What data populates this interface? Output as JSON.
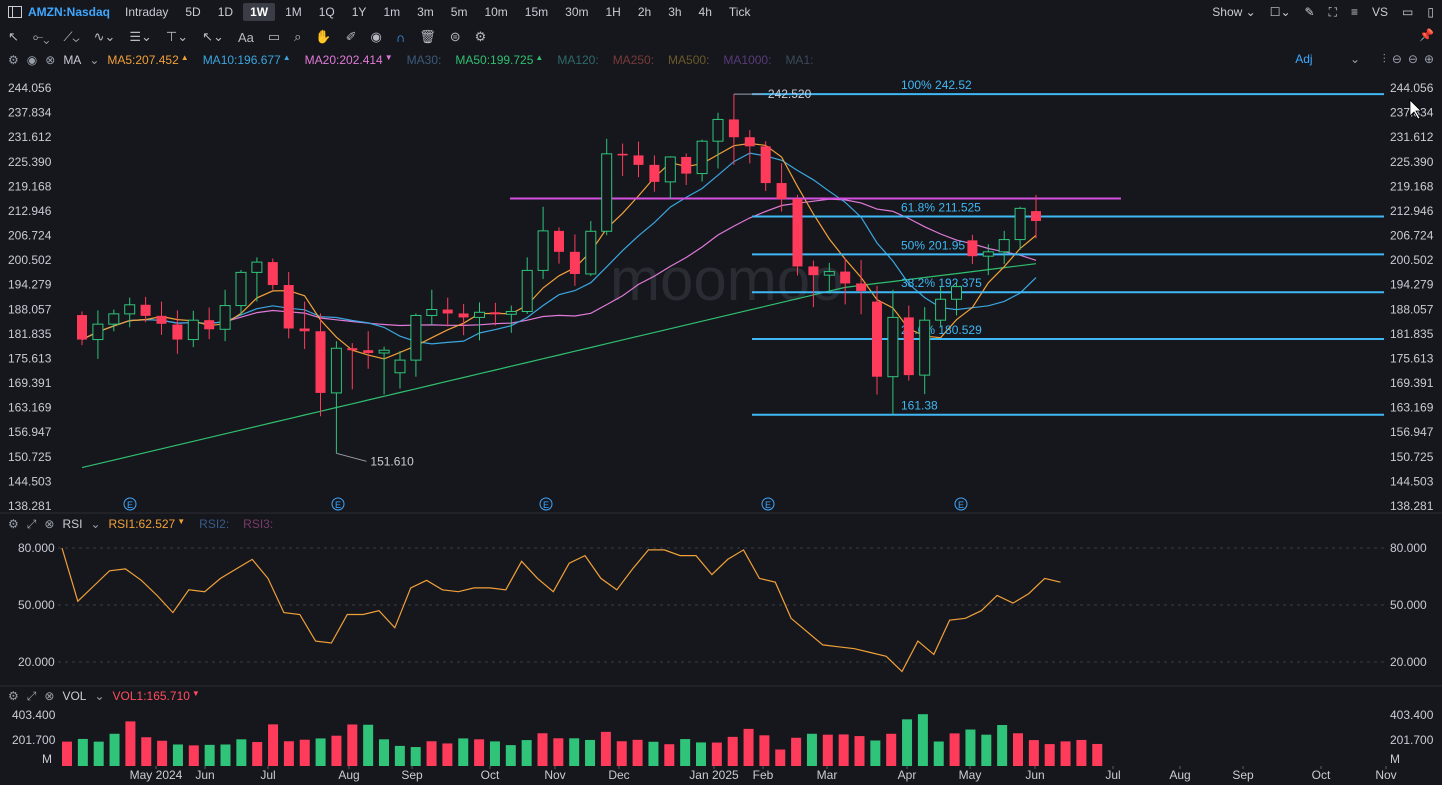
{
  "header": {
    "symbol": "AMZN:Nasdaq",
    "timeframes": [
      "Intraday",
      "5D",
      "1D",
      "1W",
      "1M",
      "1Q",
      "1Y",
      "1m",
      "3m",
      "5m",
      "10m",
      "15m",
      "30m",
      "1H",
      "2h",
      "3h",
      "4h",
      "Tick"
    ],
    "active_timeframe": "1W",
    "show_label": "Show",
    "vs_label": "VS"
  },
  "main_panel": {
    "indicator_name": "MA",
    "ma_labels": [
      {
        "text": "MA5:207.452",
        "color": "#f0a03a",
        "arrow": "▲"
      },
      {
        "text": "MA10:196.677",
        "color": "#3aa6e0",
        "arrow": "▲"
      },
      {
        "text": "MA20:202.414",
        "color": "#e07ad8",
        "arrow": "▼"
      },
      {
        "text": "MA30:",
        "color": "#3a5a7a",
        "arrow": ""
      },
      {
        "text": "MA50:199.725",
        "color": "#2fbf6f",
        "arrow": "▲"
      },
      {
        "text": "MA120:",
        "color": "#2e6a6a",
        "arrow": ""
      },
      {
        "text": "MA250:",
        "color": "#7a3a3a",
        "arrow": ""
      },
      {
        "text": "MA500:",
        "color": "#6a5a2a",
        "arrow": ""
      },
      {
        "text": "MA1000:",
        "color": "#5a3a7a",
        "arrow": ""
      },
      {
        "text": "MA1:",
        "color": "#3a4a5a",
        "arrow": ""
      }
    ],
    "adj_label": "Adj"
  },
  "rsi_panel": {
    "name": "RSI",
    "labels": [
      {
        "text": "RSI1:62.527",
        "color": "#f0a03a",
        "arrow": "▼"
      },
      {
        "text": "RSI2:",
        "color": "#3a5a8a",
        "arrow": ""
      },
      {
        "text": "RSI3:",
        "color": "#7a3a6a",
        "arrow": ""
      }
    ]
  },
  "vol_panel": {
    "name": "VOL",
    "labels": [
      {
        "text": "VOL1:165.710",
        "color": "#ff4d5e",
        "arrow": "▼"
      }
    ]
  },
  "chart_data": {
    "type": "candlestick",
    "price_axis_ticks": [
      "244.056",
      "237.834",
      "231.612",
      "225.390",
      "219.168",
      "212.946",
      "206.724",
      "200.502",
      "194.279",
      "188.057",
      "181.835",
      "175.613",
      "169.391",
      "163.169",
      "156.947",
      "150.725",
      "144.503",
      "138.281"
    ],
    "ylim": [
      138.281,
      244.056
    ],
    "x_month_labels": [
      "May 2024",
      "Jun",
      "Jul",
      "Aug",
      "Sep",
      "Oct",
      "Nov",
      "Dec",
      "Jan 2025",
      "Feb",
      "Mar",
      "Apr",
      "May",
      "Jun",
      "Jul",
      "Aug",
      "Sep",
      "Oct",
      "Nov"
    ],
    "candles": [
      [
        186.6,
        187.5,
        179.0,
        180.4
      ],
      [
        180.4,
        187.8,
        175.5,
        184.3
      ],
      [
        184.3,
        188.0,
        182.5,
        186.9
      ],
      [
        186.9,
        191.0,
        183.5,
        189.2
      ],
      [
        189.2,
        191.2,
        184.8,
        186.4
      ],
      [
        186.4,
        190.0,
        181.6,
        184.4
      ],
      [
        184.2,
        187.8,
        176.8,
        180.4
      ],
      [
        180.4,
        187.7,
        178.5,
        185.3
      ],
      [
        185.3,
        188.5,
        180.5,
        183.0
      ],
      [
        183.0,
        193.0,
        180.0,
        189.0
      ],
      [
        189.0,
        198.0,
        186.5,
        197.4
      ],
      [
        197.4,
        201.2,
        190.0,
        200.0
      ],
      [
        200.0,
        200.9,
        193.0,
        194.2
      ],
      [
        194.2,
        197.5,
        180.7,
        183.2
      ],
      [
        183.2,
        190.0,
        178.0,
        182.5
      ],
      [
        182.5,
        187.0,
        161.0,
        166.9
      ],
      [
        166.9,
        180.0,
        151.6,
        178.2
      ],
      [
        178.2,
        179.5,
        167.8,
        177.7
      ],
      [
        177.7,
        182.5,
        173.0,
        177.0
      ],
      [
        177.0,
        178.6,
        166.5,
        177.7
      ],
      [
        172.0,
        177.5,
        168.0,
        175.2
      ],
      [
        175.2,
        187.0,
        171.0,
        186.5
      ],
      [
        186.5,
        193.0,
        184.0,
        188.0
      ],
      [
        188.0,
        191.0,
        183.7,
        187.0
      ],
      [
        187.0,
        189.4,
        181.5,
        186.0
      ],
      [
        186.0,
        189.8,
        180.2,
        187.3
      ],
      [
        187.3,
        189.7,
        184.0,
        186.8
      ],
      [
        186.8,
        189.0,
        182.1,
        187.5
      ],
      [
        187.5,
        201.2,
        186.9,
        197.9
      ],
      [
        197.9,
        214.0,
        195.7,
        207.9
      ],
      [
        207.9,
        208.8,
        199.6,
        202.6
      ],
      [
        202.6,
        207.0,
        194.0,
        197.0
      ],
      [
        197.0,
        210.4,
        196.5,
        207.8
      ],
      [
        207.8,
        231.2,
        206.8,
        227.4
      ],
      [
        227.4,
        230.0,
        221.8,
        227.0
      ],
      [
        227.0,
        230.5,
        221.5,
        224.6
      ],
      [
        224.6,
        227.0,
        217.8,
        220.3
      ],
      [
        220.3,
        226.8,
        216.0,
        226.6
      ],
      [
        226.6,
        227.5,
        219.5,
        222.4
      ],
      [
        222.4,
        231.0,
        220.4,
        230.6
      ],
      [
        230.6,
        237.8,
        223.7,
        236.1
      ],
      [
        236.1,
        242.5,
        224.6,
        231.6
      ],
      [
        231.6,
        233.4,
        225.0,
        229.3
      ],
      [
        229.3,
        230.6,
        218.0,
        220.0
      ],
      [
        220.0,
        225.0,
        212.8,
        216.0
      ],
      [
        216.0,
        217.0,
        196.6,
        198.9
      ],
      [
        198.9,
        200.4,
        188.6,
        196.7
      ],
      [
        196.7,
        199.8,
        192.0,
        197.6
      ],
      [
        197.6,
        201.0,
        189.3,
        194.6
      ],
      [
        194.6,
        200.5,
        186.8,
        192.7
      ],
      [
        190.0,
        194.0,
        166.5,
        171.0
      ],
      [
        171.0,
        193.0,
        161.4,
        186.0
      ],
      [
        186.0,
        189.0,
        170.0,
        171.4
      ],
      [
        171.4,
        188.6,
        166.6,
        185.3
      ],
      [
        185.3,
        194.0,
        183.7,
        190.6
      ],
      [
        190.6,
        195.0,
        186.5,
        193.8
      ],
      [
        205.5,
        206.9,
        199.5,
        201.5
      ],
      [
        201.5,
        204.5,
        196.7,
        202.6
      ],
      [
        202.6,
        207.9,
        199.5,
        205.7
      ],
      [
        205.7,
        214.0,
        203.1,
        213.6
      ],
      [
        212.9,
        217.0,
        206.0,
        210.4
      ]
    ],
    "annotations": {
      "high_label": "242.520",
      "low_label": "151.610",
      "fib_levels": [
        {
          "label": "100% 242.52",
          "value": 242.52
        },
        {
          "label": "61.8% 211.525",
          "value": 211.525
        },
        {
          "label": "50% 201.95",
          "value": 201.95
        },
        {
          "label": "38.2% 192.375",
          "value": 192.375
        },
        {
          "label": "23.6% 180.529",
          "value": 180.529
        },
        {
          "label": "161.38",
          "value": 161.38
        }
      ],
      "horizontal_line": 216.1,
      "event_marker": "E"
    },
    "rsi": {
      "ticks": [
        "80.000",
        "50.000",
        "20.000"
      ],
      "ylim": [
        10,
        88
      ],
      "values": [
        80,
        52,
        60,
        68,
        69,
        63,
        55,
        46,
        58,
        57,
        64,
        69,
        74,
        64,
        46,
        45,
        31,
        30,
        45,
        45,
        47,
        38,
        59,
        63,
        58,
        57,
        59,
        59,
        58,
        73,
        64,
        57,
        72,
        76,
        64,
        58,
        69,
        79,
        79,
        76,
        76,
        66,
        74,
        79,
        64,
        62,
        43,
        36,
        29,
        28,
        27,
        25,
        23,
        15,
        31,
        24,
        42,
        43,
        47,
        55,
        51,
        56,
        64,
        62
      ]
    },
    "volume": {
      "ticks": [
        "403.400",
        "201.700",
        "M"
      ],
      "ylim": [
        0,
        440
      ],
      "values": [
        189,
        210,
        189,
        250,
        346,
        223,
        196,
        167,
        160,
        164,
        167,
        207,
        186,
        323,
        192,
        204,
        214,
        235,
        322,
        320,
        207,
        156,
        147,
        192,
        175,
        214,
        207,
        191,
        162,
        201,
        254,
        215,
        215,
        202,
        265,
        192,
        203,
        188,
        169,
        209,
        183,
        182,
        226,
        288,
        238,
        128,
        219,
        250,
        243,
        245,
        232,
        198,
        250,
        362,
        402,
        190,
        253,
        283,
        243,
        318,
        254,
        201,
        170,
        191,
        202,
        171
      ]
    }
  }
}
